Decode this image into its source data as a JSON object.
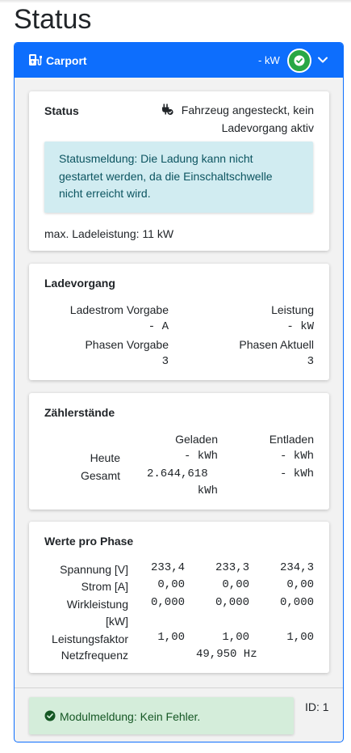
{
  "page": {
    "title": "Status"
  },
  "charge_point": {
    "name": "Carport",
    "power_summary": "- kW",
    "colors": {
      "header": "#0d6efd",
      "ok": "#28a745"
    }
  },
  "status": {
    "heading": "Status",
    "plug_state_line1": "Fahrzeug angesteckt, kein",
    "plug_state_line2": "Ladevorgang aktiv",
    "message_line1": "Statusmeldung: Die Ladung kann nicht",
    "message_line2": "gestartet werden, da die Einschaltschwelle",
    "message_line3": "nicht erreicht wird.",
    "max_power": "max. Ladeleistung: 11 kW"
  },
  "charging": {
    "heading": "Ladevorgang",
    "current_setpoint_label": "Ladestrom Vorgabe",
    "current_setpoint_value": "- A",
    "power_label": "Leistung",
    "power_value": "- kW",
    "phases_setpoint_label": "Phasen Vorgabe",
    "phases_setpoint_value": "3",
    "phases_actual_label": "Phasen Aktuell",
    "phases_actual_value": "3"
  },
  "counters": {
    "heading": "Zählerstände",
    "col_charged": "Geladen",
    "col_discharged": "Entladen",
    "today_label": "Heute",
    "today_charged": "- kWh",
    "today_discharged": "- kWh",
    "total_label": "Gesamt",
    "total_charged_line1": "2.644,618",
    "total_charged_line2": "kWh",
    "total_discharged": "- kWh"
  },
  "phases": {
    "heading": "Werte pro Phase",
    "voltage_label": "Spannung [V]",
    "voltage": [
      "233,4",
      "233,3",
      "234,3"
    ],
    "current_label": "Strom [A]",
    "current": [
      "0,00",
      "0,00",
      "0,00"
    ],
    "active_power_label_line1": "Wirkleistung",
    "active_power_label_line2": "[kW]",
    "active_power": [
      "0,000",
      "0,000",
      "0,000"
    ],
    "power_factor_label": "Leistungsfaktor",
    "power_factor": [
      "1,00",
      "1,00",
      "1,00"
    ],
    "frequency_label": "Netzfrequenz",
    "frequency": "49,950 Hz"
  },
  "footer": {
    "module_message": "Modulmeldung: Kein Fehler.",
    "id_text": "ID: 1"
  }
}
